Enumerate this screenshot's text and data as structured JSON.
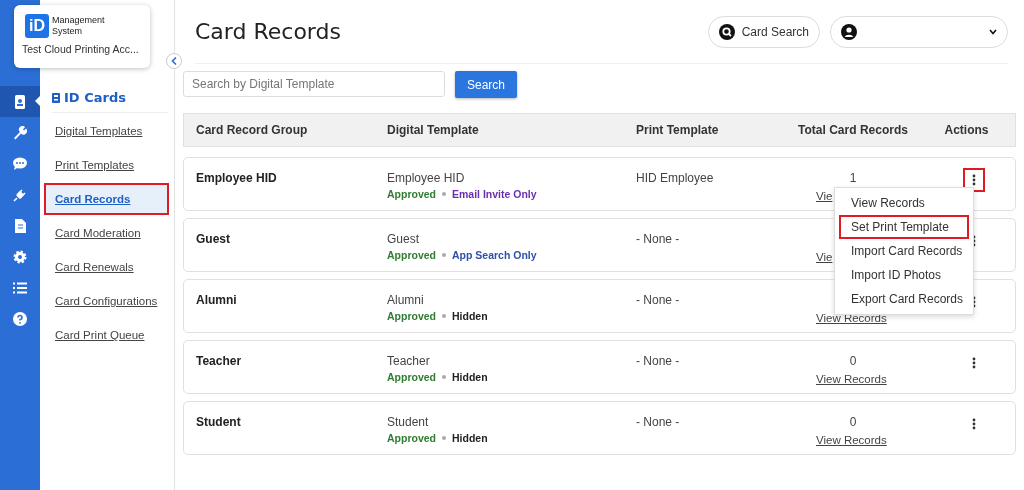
{
  "brand": {
    "logo": "iD",
    "name_line1": "Management",
    "name_line2": "System",
    "account": "Test Cloud Printing Acc..."
  },
  "rail": [
    {
      "selected": true
    },
    {
      "selected": false
    },
    {
      "selected": false
    },
    {
      "selected": false
    },
    {
      "selected": false
    },
    {
      "selected": false
    },
    {
      "selected": false
    },
    {
      "selected": false
    }
  ],
  "sidebar": {
    "heading": "ID Cards",
    "items": [
      {
        "label": "Digital Templates",
        "selected": false,
        "highlighted": false
      },
      {
        "label": "Print Templates",
        "selected": false,
        "highlighted": false
      },
      {
        "label": "Card Records",
        "selected": true,
        "highlighted": true
      },
      {
        "label": "Card Moderation",
        "selected": false,
        "highlighted": false
      },
      {
        "label": "Card Renewals",
        "selected": false,
        "highlighted": false
      },
      {
        "label": "Card Configurations",
        "selected": false,
        "highlighted": false
      },
      {
        "label": "Card Print Queue",
        "selected": false,
        "highlighted": false
      }
    ]
  },
  "page_title": "Card Records",
  "card_search": "Card Search",
  "search": {
    "placeholder": "Search by Digital Template",
    "button": "Search"
  },
  "table": {
    "columns": [
      "Card Record Group",
      "Digital Template",
      "Print Template",
      "Total Card Records",
      "Actions"
    ],
    "rows": [
      {
        "group": "Employee HID",
        "digital_template": "Employee HID",
        "status": "Approved",
        "visibility": {
          "label": "Email Invite Only",
          "color": "#6a2fb0"
        },
        "print_template": "HID Employee",
        "total": "1",
        "view_link": "Vie",
        "actions_highlighted": true
      },
      {
        "group": "Guest",
        "digital_template": "Guest",
        "status": "Approved",
        "visibility": {
          "label": "App Search Only",
          "color": "#2f4fa8"
        },
        "print_template": "- None -",
        "view_link": "Vie",
        "actions_highlighted": false
      },
      {
        "group": "Alumni",
        "digital_template": "Alumni",
        "status": "Approved",
        "visibility": {
          "label": "Hidden",
          "color": "#222222"
        },
        "print_template": "- None -",
        "view_link": "View Records",
        "actions_highlighted": false
      },
      {
        "group": "Teacher",
        "digital_template": "Teacher",
        "status": "Approved",
        "visibility": {
          "label": "Hidden",
          "color": "#222222"
        },
        "print_template": "- None -",
        "total": "0",
        "view_link": "View Records",
        "actions_highlighted": false
      },
      {
        "group": "Student",
        "digital_template": "Student",
        "status": "Approved",
        "visibility": {
          "label": "Hidden",
          "color": "#222222"
        },
        "print_template": "- None -",
        "total": "0",
        "view_link": "View Records",
        "actions_highlighted": false
      }
    ]
  },
  "actions_menu": {
    "items": [
      {
        "label": "View Records",
        "highlighted": false
      },
      {
        "label": "Set Print Template",
        "highlighted": true
      },
      {
        "label": "Import Card Records",
        "highlighted": false
      },
      {
        "label": "Import ID Photos",
        "highlighted": false
      },
      {
        "label": "Export Card Records",
        "highlighted": false
      }
    ]
  }
}
